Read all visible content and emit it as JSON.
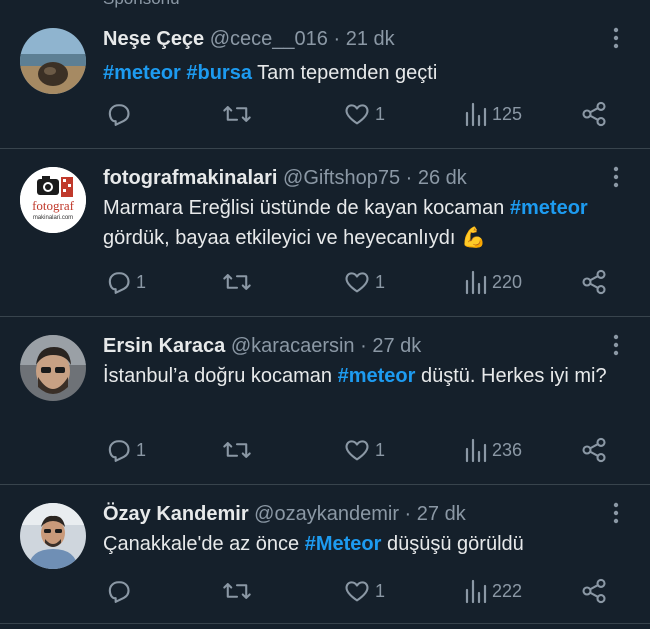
{
  "sponsored_label": "Sponsorlu",
  "tweets": [
    {
      "name": "Neşe Çeçe",
      "handle": "@cece__016",
      "time": "21 dk",
      "text_parts": [
        {
          "t": "#meteor",
          "tag": true
        },
        {
          "t": " ",
          "tag": false
        },
        {
          "t": "#bursa",
          "tag": true
        },
        {
          "t": " Tam tepemden geçti",
          "tag": false
        }
      ],
      "reply_count": "",
      "retweet_count": "",
      "like_count": "1",
      "view_count": "125"
    },
    {
      "name": "fotografmakinalari",
      "handle": "@Giftshop75",
      "time": "26 dk",
      "avatar_text": "fotograf",
      "avatar_subtext": "makinalari.com",
      "text_parts": [
        {
          "t": "Marmara Ereğlisi üstünde de kayan kocaman ",
          "tag": false
        },
        {
          "t": "#meteor",
          "tag": true
        },
        {
          "t": " gördük, bayaa etkileyici ve heyecanlıydı 💪",
          "tag": false
        }
      ],
      "reply_count": "1",
      "retweet_count": "",
      "like_count": "1",
      "view_count": "220"
    },
    {
      "name": "Ersin Karaca",
      "handle": "@karacaersin",
      "time": "27 dk",
      "text_parts": [
        {
          "t": "İstanbul’a doğru kocaman ",
          "tag": false
        },
        {
          "t": "#meteor",
          "tag": true
        },
        {
          "t": " düştü. Herkes iyi mi?",
          "tag": false
        }
      ],
      "reply_count": "1",
      "retweet_count": "",
      "like_count": "1",
      "view_count": "236"
    },
    {
      "name": "Özay Kandemir",
      "handle": "@ozaykandemir",
      "time": "27 dk",
      "text_parts": [
        {
          "t": "Çanakkale'de az önce ",
          "tag": false
        },
        {
          "t": "#Meteor",
          "tag": true
        },
        {
          "t": " düşüşü görüldü",
          "tag": false
        }
      ],
      "reply_count": "",
      "retweet_count": "",
      "like_count": "1",
      "view_count": "222"
    }
  ],
  "colors": {
    "background": "#15202b",
    "text": "#e7e9ea",
    "secondary": "#8b98a5",
    "hashtag": "#1d9bf0",
    "divider": "#38444d"
  },
  "icons": [
    "reply-icon",
    "retweet-icon",
    "like-icon",
    "views-icon",
    "share-icon",
    "more-icon"
  ]
}
